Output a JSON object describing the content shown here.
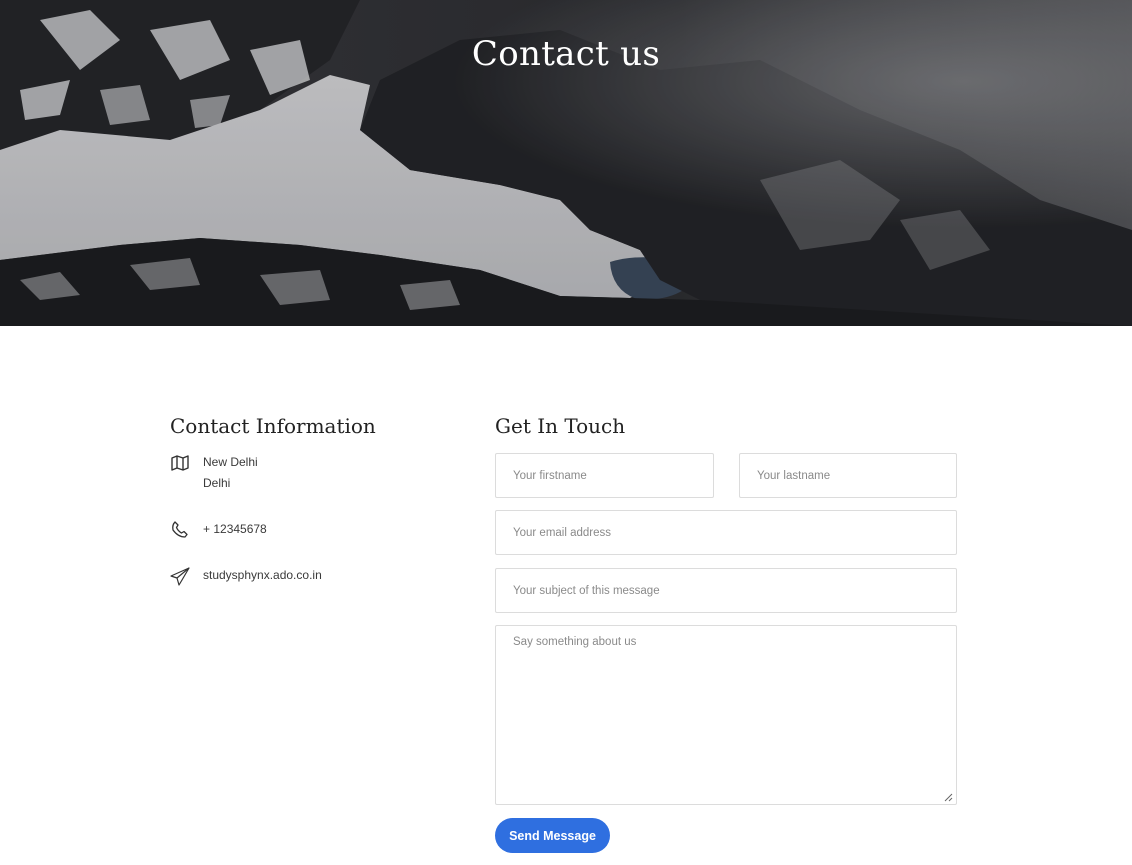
{
  "hero": {
    "title": "Contact us"
  },
  "contact_info": {
    "heading": "Contact Information",
    "address": {
      "icon": "map-icon",
      "line1": "New Delhi",
      "line2": "Delhi"
    },
    "phone": {
      "icon": "phone-icon",
      "value": "+ 12345678"
    },
    "email": {
      "icon": "paper-plane-icon",
      "value": "studysphynx.ado.co.in"
    }
  },
  "get_in_touch": {
    "heading": "Get In Touch",
    "firstname_placeholder": "Your firstname",
    "lastname_placeholder": "Your lastname",
    "email_placeholder": "Your email address",
    "subject_placeholder": "Your subject of this message",
    "message_placeholder": "Say something about us",
    "submit_label": "Send Message"
  },
  "colors": {
    "accent": "#2f6fe0",
    "heading_text": "#222222",
    "body_text": "#3a3a3a",
    "field_border": "#dcdcdc"
  }
}
